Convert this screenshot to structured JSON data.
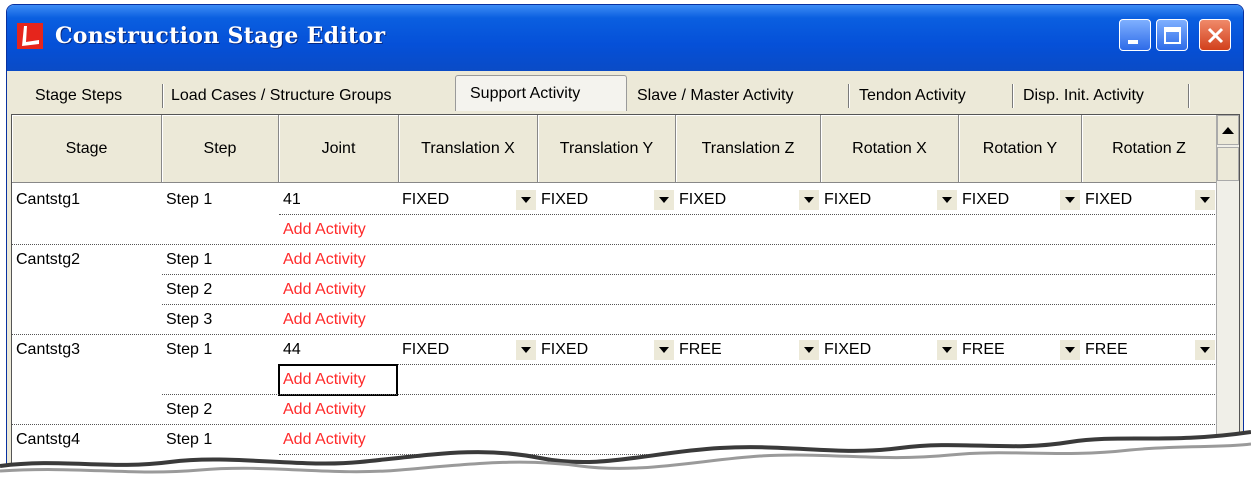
{
  "window": {
    "title": "Construction Stage Editor"
  },
  "tabs": [
    {
      "label": "Stage Steps",
      "active": false
    },
    {
      "label": "Load Cases / Structure Groups",
      "active": false
    },
    {
      "label": "Support Activity",
      "active": true
    },
    {
      "label": "Slave / Master Activity",
      "active": false
    },
    {
      "label": "Tendon Activity",
      "active": false
    },
    {
      "label": "Disp. Init. Activity",
      "active": false
    }
  ],
  "grid": {
    "headers": [
      "Stage",
      "Step",
      "Joint",
      "Translation X",
      "Translation Y",
      "Translation Z",
      "Rotation X",
      "Rotation Y",
      "Rotation Z"
    ],
    "rows": [
      {
        "stage": "Cantstg1",
        "step": "Step 1",
        "joint": "41",
        "values": [
          "FIXED",
          "FIXED",
          "FIXED",
          "FIXED",
          "FIXED",
          "FIXED"
        ]
      },
      {
        "stage": "",
        "step": "",
        "joint": "Add Activity",
        "link": true
      },
      {
        "stage": "Cantstg2",
        "step": "Step 1",
        "joint": "Add Activity",
        "link": true
      },
      {
        "stage": "",
        "step": "Step 2",
        "joint": "Add Activity",
        "link": true
      },
      {
        "stage": "",
        "step": "Step 3",
        "joint": "Add Activity",
        "link": true
      },
      {
        "stage": "Cantstg3",
        "step": "Step 1",
        "joint": "44",
        "values": [
          "FIXED",
          "FIXED",
          "FREE",
          "FIXED",
          "FREE",
          "FREE"
        ]
      },
      {
        "stage": "",
        "step": "",
        "joint": "Add Activity",
        "link": true,
        "focused": true
      },
      {
        "stage": "",
        "step": "Step 2",
        "joint": "Add Activity",
        "link": true
      },
      {
        "stage": "Cantstg4",
        "step": "Step 1",
        "joint": "Add Activity",
        "link": true
      }
    ]
  },
  "colors": {
    "titlebar": "#0550d8",
    "link": "#ff2a2a",
    "chrome": "#ece9d8"
  },
  "icons": {
    "app": "logo-icon",
    "minimize": "minimize-icon",
    "maximize": "maximize-icon",
    "close": "close-icon",
    "scroll_up": "scroll-up-icon",
    "dropdown": "dropdown-arrow-icon"
  }
}
